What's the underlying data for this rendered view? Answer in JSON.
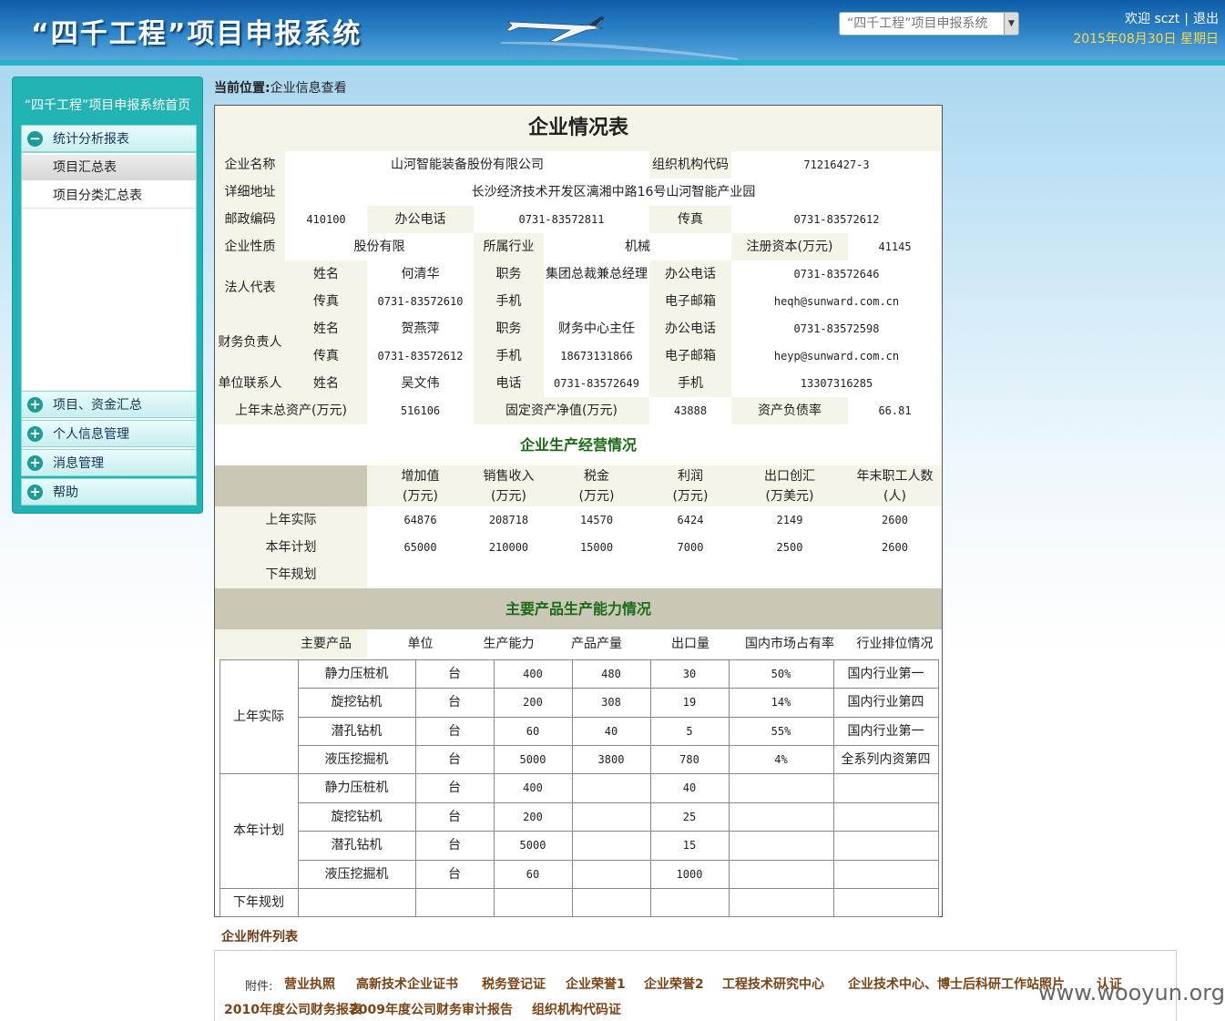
{
  "header": {
    "title": "“四千工程”项目申报系统",
    "system_select": "“四千工程”项目申报系统",
    "welcome_prefix": "欢迎",
    "username": "sczt",
    "logout": "退出",
    "date": "2015年08月30日 星期日"
  },
  "sidebar": {
    "home": "“四千工程”项目申报系统首页",
    "groups": [
      "统计分析报表",
      "项目、资金汇总",
      "个人信息管理",
      "消息管理",
      "帮助"
    ],
    "sub_items": [
      "项目汇总表",
      "项目分类汇总表"
    ]
  },
  "breadcrumb": {
    "label": "当前位置:",
    "value": "企业信息查看"
  },
  "company": {
    "table_title": "企业情况表",
    "name_label": "企业名称",
    "name": "山河智能装备股份有限公司",
    "org_code_label": "组织机构代码",
    "org_code": "71216427-3",
    "address_label": "详细地址",
    "address": "长沙经济技术开发区漓湘中路16号山河智能产业园",
    "postcode_label": "邮政编码",
    "postcode": "410100",
    "office_phone_label": "办公电话",
    "office_phone": "0731-83572811",
    "fax_label": "传真",
    "fax": "0731-83572612",
    "nature_label": "企业性质",
    "nature": "股份有限",
    "industry_label": "所属行业",
    "industry": "机械",
    "capital_label": "注册资本(万元)",
    "capital": "41145",
    "legal_label": "法人代表",
    "finance_label": "财务负责人",
    "contact_label": "单位联系人",
    "f_name": "姓名",
    "f_title": "职务",
    "f_office": "办公电话",
    "f_fax": "传真",
    "f_mobile": "手机",
    "f_email": "电子邮箱",
    "f_phone": "电话",
    "legal": {
      "name": "何清华",
      "title": "集团总裁兼总经理",
      "office": "0731-83572646",
      "fax": "0731-83572610",
      "mobile": "",
      "email": "heqh@sunward.com.cn"
    },
    "finance": {
      "name": "贺燕萍",
      "title": "财务中心主任",
      "office": "0731-83572598",
      "fax": "0731-83572612",
      "mobile": "18673131866",
      "email": "heyp@sunward.com.cn"
    },
    "contact": {
      "name": "吴文伟",
      "phone": "0731-83572649",
      "mobile": "13307316285"
    },
    "assets_label": "上年末总资产(万元)",
    "assets": "516106",
    "fixed_label": "固定资产净值(万元)",
    "fixed": "43888",
    "debt_label": "资产负债率",
    "debt": "66.81"
  },
  "production": {
    "title": "企业生产经营情况",
    "headers": [
      [
        "增加值",
        "(万元)"
      ],
      [
        "销售收入",
        "(万元)"
      ],
      [
        "税金",
        "(万元)"
      ],
      [
        "利润",
        "(万元)"
      ],
      [
        "出口创汇",
        "(万美元)"
      ],
      [
        "年末职工人数",
        "(人)"
      ]
    ],
    "rows": [
      {
        "label": "上年实际",
        "values": [
          "64876",
          "208718",
          "14570",
          "6424",
          "2149",
          "2600"
        ]
      },
      {
        "label": "本年计划",
        "values": [
          "65000",
          "210000",
          "15000",
          "7000",
          "2500",
          "2600"
        ]
      },
      {
        "label": "下年规划",
        "values": [
          "",
          "",
          "",
          "",
          "",
          ""
        ]
      }
    ]
  },
  "capacity": {
    "title": "主要产品生产能力情况",
    "headers": [
      "主要产品",
      "单位",
      "生产能力",
      "产品产量",
      "出口量",
      "国内市场占有率",
      "行业排位情况"
    ],
    "groups": [
      {
        "label": "上年实际",
        "rows": [
          [
            "静力压桩机",
            "台",
            "400",
            "480",
            "30",
            "50%",
            "国内行业第一"
          ],
          [
            "旋挖钻机",
            "台",
            "200",
            "308",
            "19",
            "14%",
            "国内行业第四"
          ],
          [
            "潜孔钻机",
            "台",
            "60",
            "40",
            "5",
            "55%",
            "国内行业第一"
          ],
          [
            "液压挖掘机",
            "台",
            "5000",
            "3800",
            "780",
            "4%",
            "全系列内资第四"
          ]
        ]
      },
      {
        "label": "本年计划",
        "rows": [
          [
            "静力压桩机",
            "台",
            "400",
            "",
            "40",
            "",
            ""
          ],
          [
            "旋挖钻机",
            "台",
            "200",
            "",
            "25",
            "",
            ""
          ],
          [
            "潜孔钻机",
            "台",
            "5000",
            "",
            "15",
            "",
            ""
          ],
          [
            "液压挖掘机",
            "台",
            "60",
            "",
            "1000",
            "",
            ""
          ]
        ]
      },
      {
        "label": "下年规划",
        "rows": [
          [
            "",
            "",
            "",
            "",
            "",
            "",
            ""
          ]
        ]
      }
    ]
  },
  "attachments": {
    "title": "企业附件列表",
    "prefix": "附件:",
    "items": [
      "营业执照",
      "高新技术企业证书",
      "税务登记证",
      "企业荣誉1",
      "企业荣誉2",
      "工程技术研究中心",
      "企业技术中心、博士后科研工作站照片",
      "认证",
      "2010年度公司财务报表",
      "2009年度公司财务审计报告",
      "组织机构代码证"
    ]
  },
  "watermark": "www.wooyun.org"
}
